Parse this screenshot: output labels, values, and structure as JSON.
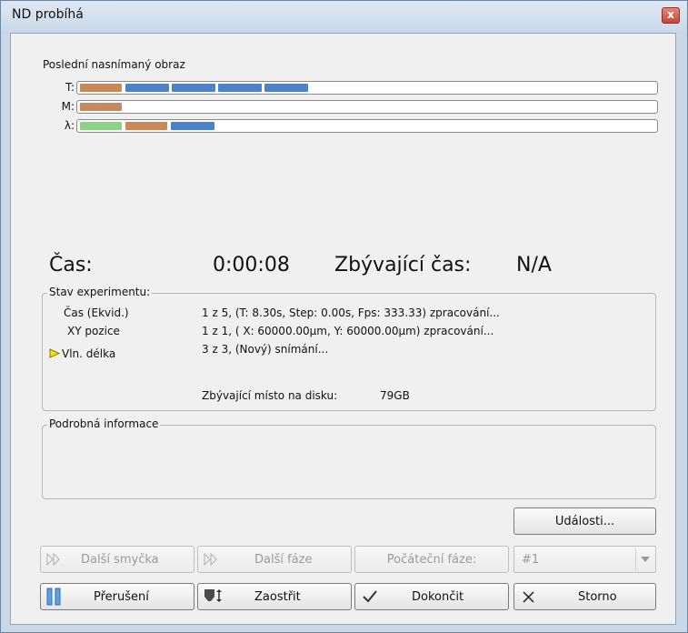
{
  "window": {
    "title": "ND probíhá",
    "close_glyph": "x"
  },
  "last_image": {
    "label": "Poslední nasnímaný obraz",
    "rows": [
      {
        "label": "T:"
      },
      {
        "label": "M:"
      },
      {
        "label": "λ:"
      }
    ]
  },
  "timing": {
    "time_label": "Čas:",
    "time_value": "0:00:08",
    "remaining_label": "Zbývající čas:",
    "remaining_value": "N/A"
  },
  "experiment": {
    "title": "Stav experimentu:",
    "rows": [
      {
        "name": "Čas (Ekvid.)",
        "status": "1 z 5, (T: 8.30s, Step: 0.00s, Fps: 333.33) zpracování..."
      },
      {
        "name": "XY pozice",
        "status": "1 z 1, ( X: 60000.00µm, Y: 60000.00µm) zpracování..."
      },
      {
        "name": "Vln. délka",
        "status": "3 z 3, (Nový) snímání..."
      }
    ],
    "disk_label": "Zbývající místo na disku:",
    "disk_value": "79GB"
  },
  "details": {
    "title": "Podrobná informace"
  },
  "buttons": {
    "events": "Události...",
    "next_loop": "Další smyčka",
    "next_phase": "Další fáze",
    "start_phase": "Počáteční fáze:",
    "phase_select": "#1",
    "pause": "Přerušení",
    "focus": "Zaostřit",
    "finish": "Dokončit",
    "cancel": "Storno"
  },
  "colors": {
    "bar_orange": "#c8895a",
    "bar_blue": "#4f81c7",
    "bar_green": "#8fd08a",
    "arrow_yellow": "#f5e400"
  }
}
